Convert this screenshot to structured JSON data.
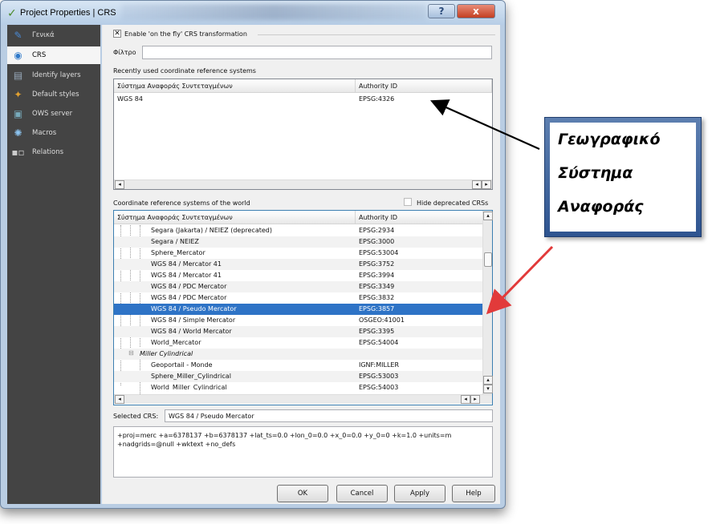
{
  "window": {
    "title": "Project Properties | CRS",
    "help_btn": "?",
    "close_btn": "x"
  },
  "sidebar": {
    "items": [
      {
        "label": "Γενικά",
        "icon": "wrench-icon"
      },
      {
        "label": "CRS",
        "icon": "globe-icon"
      },
      {
        "label": "Identify layers",
        "icon": "identify-icon"
      },
      {
        "label": "Default styles",
        "icon": "paint-icon"
      },
      {
        "label": "OWS server",
        "icon": "server-icon"
      },
      {
        "label": "Macros",
        "icon": "gear-icon"
      },
      {
        "label": "Relations",
        "icon": "relations-icon"
      }
    ]
  },
  "crs": {
    "enable_checkbox_mark": "✕",
    "enable_label": "Enable 'on the fly' CRS transformation",
    "filter_label": "Φίλτρο",
    "filter_value": "",
    "recent_label": "Recently used coordinate reference systems",
    "col_name": "Σύστημα Αναφοράς Συντεταγμένων",
    "col_auth": "Authority ID",
    "recent_rows": [
      {
        "name": "WGS 84",
        "auth": "EPSG:4326"
      }
    ],
    "world_label": "Coordinate reference systems of the world",
    "hide_deprecated_label": "Hide deprecated CRSs",
    "world_rows": [
      {
        "name": "Segara (Jakarta) / NEIEZ (deprecated)",
        "auth": "EPSG:2934"
      },
      {
        "name": "Segara / NEIEZ",
        "auth": "EPSG:3000"
      },
      {
        "name": "Sphere_Mercator",
        "auth": "EPSG:53004"
      },
      {
        "name": "WGS 84 / Mercator 41",
        "auth": "EPSG:3752"
      },
      {
        "name": "WGS 84 / Mercator 41",
        "auth": "EPSG:3994"
      },
      {
        "name": "WGS 84 / PDC Mercator",
        "auth": "EPSG:3349"
      },
      {
        "name": "WGS 84 / PDC Mercator",
        "auth": "EPSG:3832"
      },
      {
        "name": "WGS 84 / Pseudo Mercator",
        "auth": "EPSG:3857"
      },
      {
        "name": "WGS 84 / Simple Mercator",
        "auth": "OSGEO:41001"
      },
      {
        "name": "WGS 84 / World Mercator",
        "auth": "EPSG:3395"
      },
      {
        "name": "World_Mercator",
        "auth": "EPSG:54004"
      },
      {
        "name": "Miller Cylindrical",
        "auth": ""
      },
      {
        "name": "Geoportail - Monde",
        "auth": "IGNF:MILLER"
      },
      {
        "name": "Sphere_Miller_Cylindrical",
        "auth": "EPSG:53003"
      },
      {
        "name": "World_Miller_Cylindrical",
        "auth": "EPSG:54003"
      }
    ],
    "tree_toggle": "⊟",
    "selected_crs_label": "Selected CRS:",
    "selected_crs_value": "WGS 84 / Pseudo Mercator",
    "proj_text_1": "+proj=merc +a=6378137 +b=6378137 +lat_ts=0.0 +lon_0=0.0 +x_0=0.0 +y_0=0 +k=1.0 +units=m",
    "proj_text_2": "+nadgrids=@null +wktext  +no_defs"
  },
  "buttons": {
    "ok": "OK",
    "cancel": "Cancel",
    "apply": "Apply",
    "help": "Help"
  },
  "annotation": {
    "line1": "Γεωγραφικό",
    "line2": "Σύστημα",
    "line3": "Αναφοράς"
  },
  "colors": {
    "selection": "#2e73c6",
    "sidebar_bg": "#444444",
    "arrow_red": "#e23a3a",
    "arrow_black": "#000000",
    "note_border": "#2e5490"
  }
}
